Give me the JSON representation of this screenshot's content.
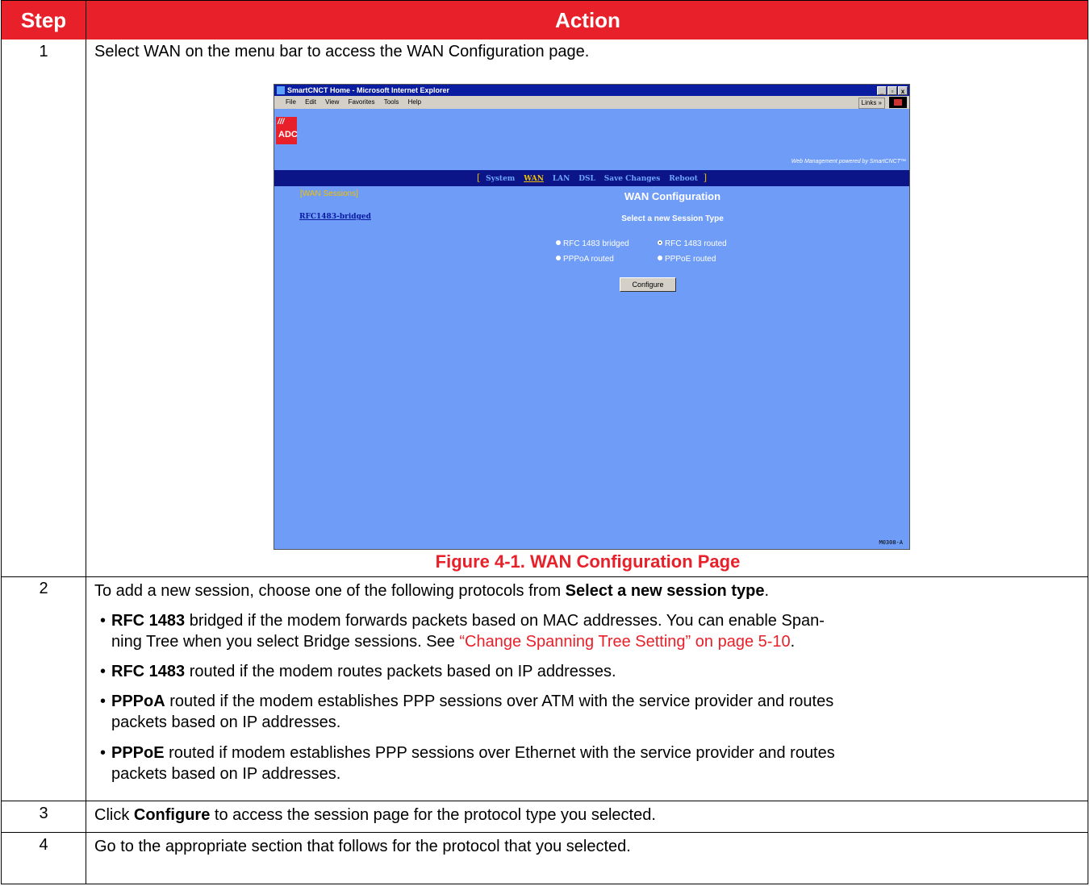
{
  "table": {
    "headers": {
      "step": "Step",
      "action": "Action"
    },
    "rows": [
      {
        "step": "1",
        "text": "Select WAN on the menu bar to access the WAN Configuration page."
      },
      {
        "step": "2",
        "intro": "To add a new session, choose one of the following protocols from ",
        "intro_bold": "Select a new session type",
        "intro_end": ".",
        "bullets": [
          {
            "bold": "RFC 1483",
            "line1": " bridged if the modem forwards packets based on MAC addresses. You can enable Span-",
            "line2_pre": "ning Tree when you select Bridge sessions. See ",
            "xref": "“Change Spanning Tree Setting” on page 5-10",
            "line2_end": "."
          },
          {
            "bold": "RFC 1483",
            "line1": " routed if the modem routes packets based on IP addresses."
          },
          {
            "bold": "PPPoA",
            "line1": " routed if the modem establishes PPP sessions over ATM with the service provider and routes",
            "line2": "packets based on IP addresses."
          },
          {
            "bold": "PPPoE",
            "line1": " routed if modem establishes PPP sessions over Ethernet with the service provider and routes",
            "line2": "packets based on IP addresses."
          }
        ]
      },
      {
        "step": "3",
        "pre": "Click ",
        "bold": "Configure",
        "post": " to access the session page for the protocol type you selected."
      },
      {
        "step": "4",
        "text": "Go to the appropriate section that follows for the protocol that you selected."
      }
    ]
  },
  "figure": {
    "caption": "Figure 4-1. WAN Configuration Page",
    "id": "M0308-A",
    "window_title": "SmartCNCT Home - Microsoft Internet Explorer",
    "window_buttons": [
      "_",
      "▫",
      "x"
    ],
    "menu": [
      "File",
      "Edit",
      "View",
      "Favorites",
      "Tools",
      "Help"
    ],
    "links_label": "Links »",
    "logo_text": "ADC",
    "logo_slashes": "///",
    "powered_by": "Web Management powered by SmartCNCT™",
    "nav": {
      "open": "[",
      "items": [
        "System",
        "WAN",
        "LAN",
        "DSL",
        "Save Changes",
        "Reboot"
      ],
      "close": "]",
      "active": "WAN"
    },
    "wan_sessions": "[WAN Sessions]",
    "session_link": "RFC1483-bridged",
    "page_title": "WAN Configuration",
    "subtitle": "Select a new Session Type",
    "options": [
      "RFC 1483 bridged",
      "RFC 1483 routed",
      "PPPoA routed",
      "PPPoE routed"
    ],
    "selected_option": "RFC 1483 routed",
    "configure_button": "Configure",
    "colors": {
      "header_red": "#e8202a",
      "page_blue": "#6f9cf6",
      "nav_navy": "#0b1587",
      "accent_yellow": "#f0c000"
    }
  }
}
